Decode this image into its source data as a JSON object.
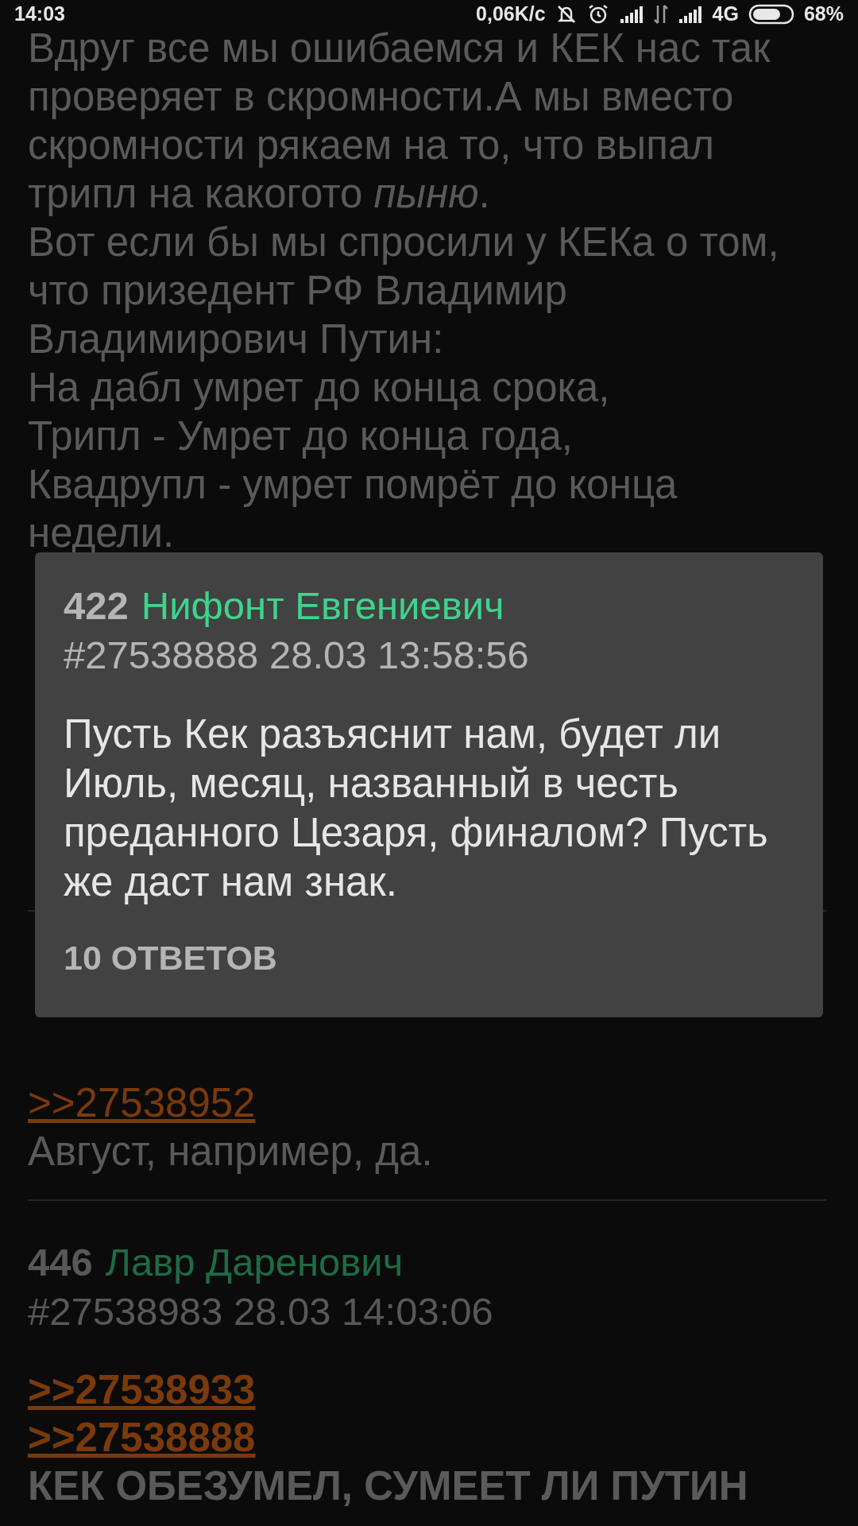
{
  "status_bar": {
    "time": "14:03",
    "speed": "0,06K/с",
    "network": "4G",
    "battery": "68%"
  },
  "posts": [
    {
      "paragraphs": [
        "Вдруг все мы ошибаемся и КЕК нас так проверяет в скромности.А мы вместо скромности рякаем на то, что выпал трипл на какогото *пыню*.",
        "Вот если бы мы спросили у КЕКа о том, что призедент РФ Владимир Владимирович Путин:",
        "На дабл умрет до конца срока,",
        "Трипл - Умрет до конца года,",
        "Квадрупл - умрет помрёт до конца недели."
      ]
    },
    {
      "replies": [
        ">>27538952"
      ],
      "paragraphs": [
        "Август, например, да."
      ]
    },
    {
      "number": "446",
      "name": "Лавр Даренович",
      "meta": "#27538983 28.03 14:03:06",
      "bold": true,
      "replies": [
        ">>27538933",
        ">>27538888"
      ],
      "paragraphs": [
        "КЕК ОБЕЗУМЕЛ, СУМЕЕТ ЛИ ПУТИН"
      ]
    }
  ],
  "popup": {
    "number": "422",
    "name": "Нифонт Евгениевич",
    "meta": "#27538888 28.03 13:58:56",
    "text": "Пусть Кек разъяснит нам, будет ли Июль, месяц, названный в честь преданного Цезаря, финалом? Пусть же даст нам знак.",
    "replies_button": "10 ОТВЕТОВ"
  }
}
